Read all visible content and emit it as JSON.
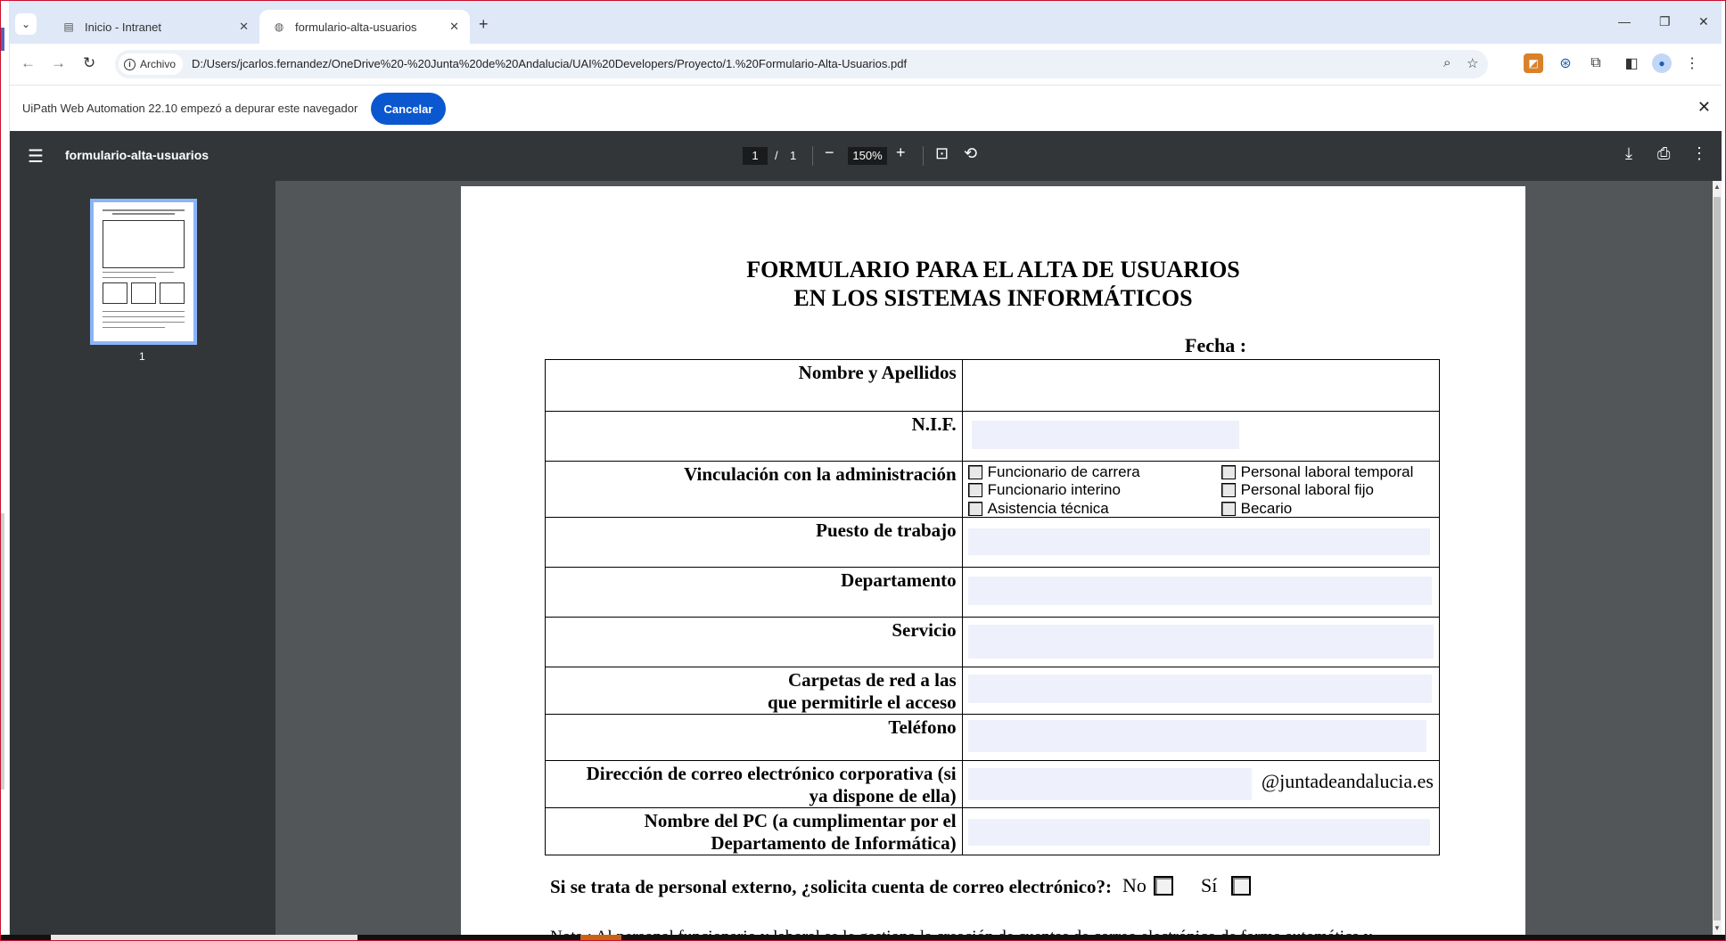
{
  "browser": {
    "tabs": [
      {
        "title": "Inicio - Intranet",
        "icon": "intranet-icon",
        "active": false
      },
      {
        "title": "formulario-alta-usuarios",
        "icon": "globe-icon",
        "active": true
      }
    ],
    "security_chip": "Archivo",
    "url": "D:/Users/jcarlos.fernandez/OneDrive%20-%20Junta%20de%20Andalucia/UAI%20Developers/Proyecto/1.%20Formulario-Alta-Usuarios.pdf"
  },
  "infobar": {
    "message": "UiPath Web Automation 22.10 empezó a depurar este navegador",
    "cancel_label": "Cancelar"
  },
  "pdf_toolbar": {
    "title": "formulario-alta-usuarios",
    "current_page": "1",
    "page_sep": "/",
    "total_pages": "1",
    "zoom": "150%"
  },
  "sidebar": {
    "thumbnail_label": "1"
  },
  "document": {
    "title_line1": "FORMULARIO PARA EL ALTA DE USUARIOS",
    "title_line2": "EN LOS SISTEMAS INFORMÁTICOS",
    "fecha_label": "Fecha :",
    "rows": {
      "nombre": "Nombre y Apellidos",
      "nif": "N.I.F.",
      "vinculacion": "Vinculación con la administración",
      "puesto": "Puesto de trabajo",
      "departamento": "Departamento",
      "servicio": "Servicio",
      "carpetas_line1": "Carpetas de red a las",
      "carpetas_line2": "que permitirle el acceso",
      "telefono": "Teléfono",
      "correo_line1": "Dirección de correo electrónico corporativa (si",
      "correo_line2": "ya dispone de ella)",
      "pc_line1": "Nombre del PC (a cumplimentar por el",
      "pc_line2": "Departamento de Informática)"
    },
    "vinculacion_options": {
      "funcionario_carrera": "Funcionario de carrera",
      "funcionario_interino": "Funcionario interino",
      "asistencia_tecnica": "Asistencia técnica",
      "laboral_temporal": "Personal laboral temporal",
      "laboral_fijo": "Personal laboral fijo",
      "becario": "Becario"
    },
    "email_suffix": "@juntadeandalucia.es",
    "question": "Si se trata de personal externo, ¿solicita cuenta de correo electrónico?:",
    "answer_no": "No",
    "answer_si": "Sí",
    "nota": "Nota : Al personal funcionario y laboral se le gestiona la creación de cuentas de correo electrónico de forma automática y"
  }
}
